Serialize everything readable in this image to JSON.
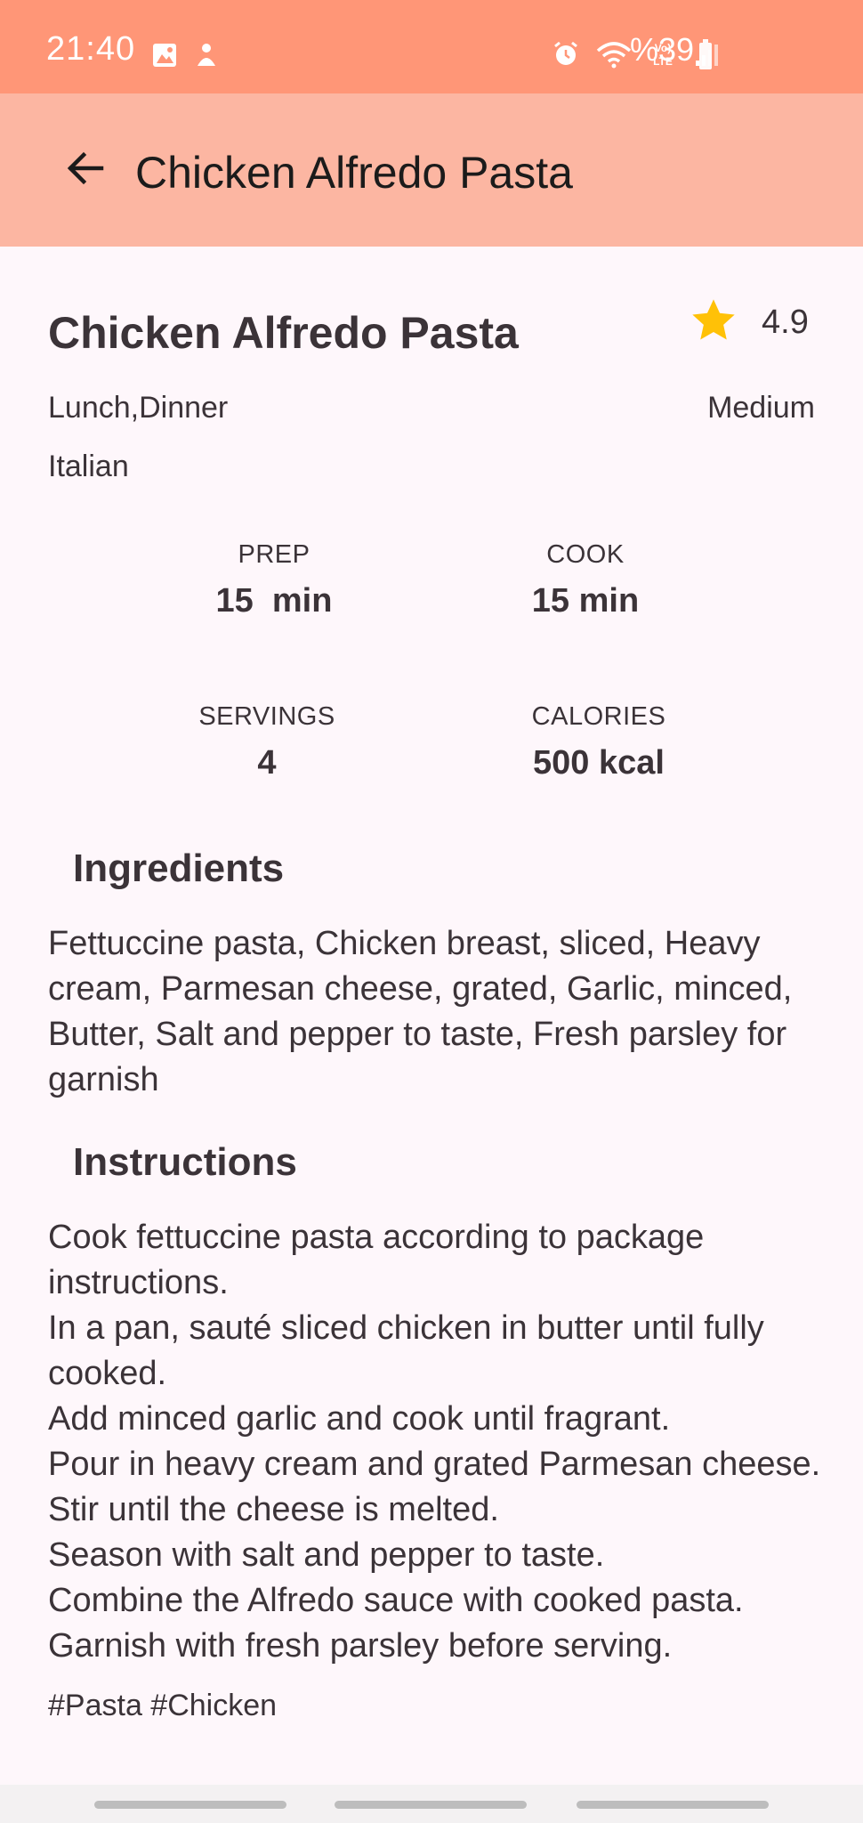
{
  "status_bar": {
    "time": "21:40",
    "battery": "%39",
    "icons": [
      "image-icon",
      "notification-icon",
      "alarm-icon",
      "wifi-icon",
      "volte-icon",
      "signal-icon",
      "battery-icon"
    ],
    "background": "#FF9677"
  },
  "app_bar": {
    "title": "Chicken Alfredo Pasta",
    "back_icon": "arrow-left-icon",
    "background": "#FCB6A2"
  },
  "recipe": {
    "name": "Chicken Alfredo Pasta",
    "rating": "4.9",
    "meal_types": "Lunch,Dinner",
    "difficulty": "Medium",
    "cuisine": "Italian",
    "stats": {
      "prep_label": "PREP",
      "prep_value": "15  min",
      "cook_label": "COOK",
      "cook_value": "15 min",
      "servings_label": "SERVINGS",
      "servings_value": "4",
      "calories_label": "CALORIES",
      "calories_value": "500 kcal"
    },
    "ingredients_heading": "Ingredients",
    "ingredients": "Fettuccine pasta, Chicken breast, sliced, Heavy cream, Parmesan cheese, grated, Garlic, minced, Butter, Salt and pepper to taste, Fresh parsley for garnish",
    "instructions_heading": "Instructions",
    "instructions": [
      "Cook fettuccine pasta according to package instructions.",
      "In a pan, sauté sliced chicken in butter until fully cooked.",
      "Add minced garlic and cook until fragrant.",
      "Pour in heavy cream and grated Parmesan cheese. Stir until the cheese is melted.",
      "Season with salt and pepper to taste.",
      "Combine the Alfredo sauce with cooked pasta.",
      "Garnish with fresh parsley before serving."
    ],
    "tags": "#Pasta #Chicken"
  },
  "colors": {
    "star": "#FFC107",
    "text": "#3b3338",
    "page_background": "#FEF7FB"
  }
}
